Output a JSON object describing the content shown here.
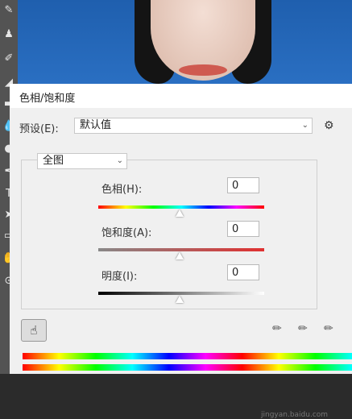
{
  "dialog": {
    "title": "色相/饱和度",
    "preset_label": "预设(E):",
    "preset_value": "默认值",
    "channel_value": "全图",
    "hue": {
      "label": "色相(H):",
      "value": "0"
    },
    "saturation": {
      "label": "饱和度(A):",
      "value": "0"
    },
    "lightness": {
      "label": "明度(I):",
      "value": "0"
    }
  },
  "tools": [
    "brush-icon",
    "stamp-icon",
    "history-brush-icon",
    "eraser-icon",
    "gradient-icon",
    "blur-icon",
    "dodge-icon",
    "pen-icon",
    "type-icon",
    "path-select-icon",
    "shape-icon",
    "hand-icon",
    "zoom-icon"
  ],
  "watermark": "jingyan.baidu.com"
}
